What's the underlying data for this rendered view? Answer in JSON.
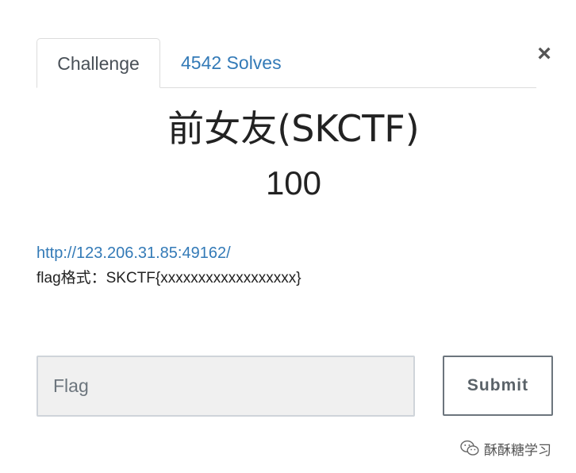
{
  "tabs": {
    "challenge": "Challenge",
    "solves": "4542 Solves"
  },
  "close_label": "×",
  "challenge": {
    "name": "前女友(SKCTF)",
    "points": "100",
    "link": "http://123.206.31.85:49162/",
    "flag_format": "flag格式：SKCTF{xxxxxxxxxxxxxxxxxx}"
  },
  "form": {
    "placeholder": "Flag",
    "value": "",
    "submit_label": "Submit"
  },
  "watermark": {
    "text": "酥酥糖学习",
    "icon": "wechat-icon"
  }
}
